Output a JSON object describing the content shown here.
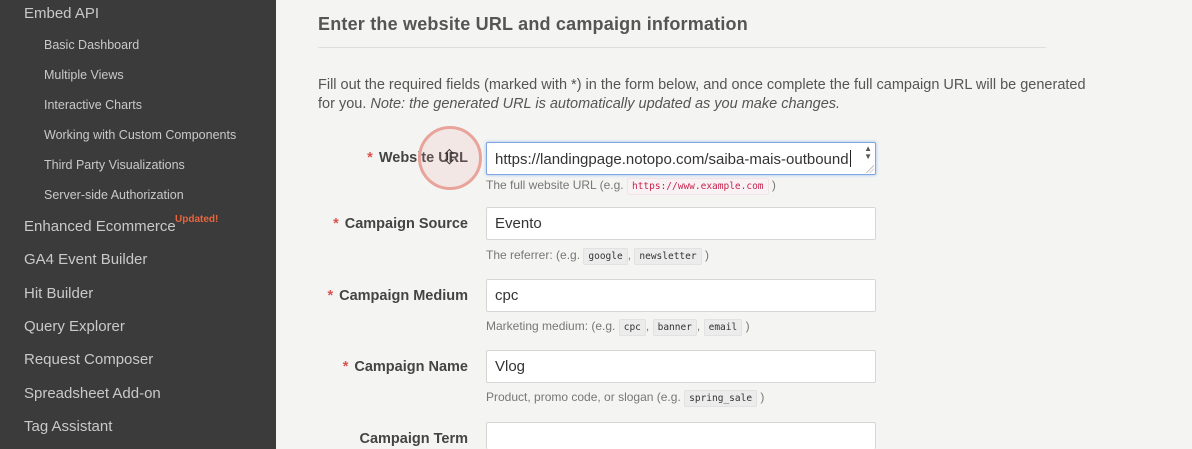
{
  "sidebar": {
    "items": [
      {
        "label": "Embed API"
      },
      {
        "label": "Basic Dashboard"
      },
      {
        "label": "Multiple Views"
      },
      {
        "label": "Interactive Charts"
      },
      {
        "label": "Working with Custom Components"
      },
      {
        "label": "Third Party Visualizations"
      },
      {
        "label": "Server-side Authorization"
      },
      {
        "label": "Enhanced Ecommerce"
      },
      {
        "label": "GA4 Event Builder"
      },
      {
        "label": "Hit Builder"
      },
      {
        "label": "Query Explorer"
      },
      {
        "label": "Request Composer"
      },
      {
        "label": "Spreadsheet Add-on"
      },
      {
        "label": "Tag Assistant"
      }
    ],
    "badge": "Updated!"
  },
  "main": {
    "section_title": "Enter the website URL and campaign information",
    "intro_text": "Fill out the required fields (marked with *) in the form below, and once complete the full campaign URL will be generated for you.",
    "intro_note": "Note: the generated URL is automatically updated as you make changes.",
    "required_mark": "*",
    "fields": [
      {
        "label": "Website URL",
        "value": "https://landingpage.notopo.com/saiba-mais-outbound",
        "help_prefix": "The full website URL (e.g.",
        "help_codes": [
          "https://www.example.com"
        ],
        "help_suffix": ")"
      },
      {
        "label": "Campaign Source",
        "value": "Evento",
        "help_prefix": "The referrer: (e.g.",
        "help_codes": [
          "google",
          "newsletter"
        ],
        "help_suffix": ")"
      },
      {
        "label": "Campaign Medium",
        "value": "cpc",
        "help_prefix": "Marketing medium: (e.g.",
        "help_codes": [
          "cpc",
          "banner",
          "email"
        ],
        "help_suffix": ")"
      },
      {
        "label": "Campaign Name",
        "value": "Vlog",
        "help_prefix": "Product, promo code, or slogan (e.g.",
        "help_codes": [
          "spring_sale"
        ],
        "help_suffix": ")"
      },
      {
        "label": "Campaign Term",
        "value": ""
      }
    ],
    "separator": ","
  }
}
